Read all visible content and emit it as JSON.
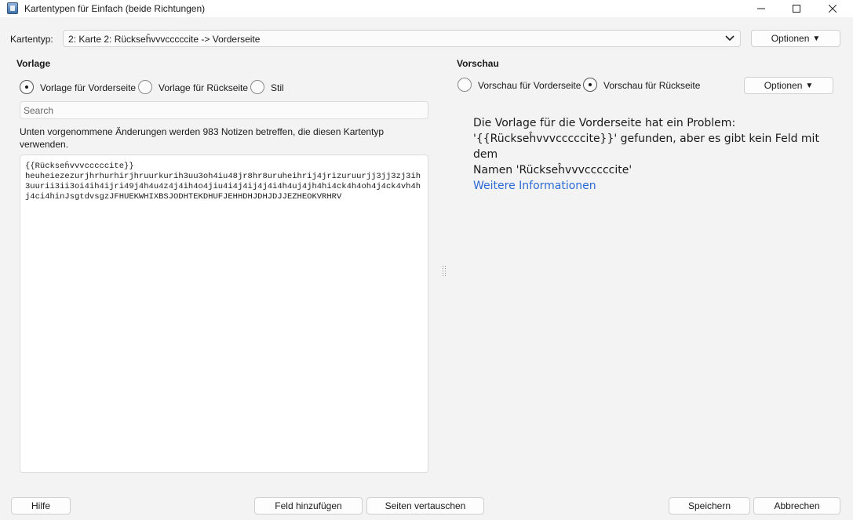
{
  "window": {
    "title": "Kartentypen für Einfach (beide Richtungen)"
  },
  "cardtype": {
    "label": "Kartentyp:",
    "selected": "2: Karte 2: Rückseĥvvvcccccite -> Vorderseite",
    "options_label": "Optionen"
  },
  "template": {
    "heading": "Vorlage",
    "radios": [
      {
        "label": "Vorlage für Vorderseite",
        "checked": true
      },
      {
        "label": "Vorlage für Rückseite",
        "checked": false
      },
      {
        "label": "Stil",
        "checked": false
      }
    ],
    "search_placeholder": "Search",
    "info": "Unten vorgenommene Änderungen werden 983 Notizen betreffen, die diesen Kartentyp verwenden.",
    "content": "{{Rückseĥvvvcccccite}}\nheuheiezezurjhrhurhirjhruurkurih3uu3oh4iu48jr8hr8uruheihrij4jrizuruurjj3jj3zj3ih3uurii3ii3oi4ih4ijri49j4h4u4z4j4ih4o4jiu4i4j4ij4j4i4h4uj4jh4hi4ck4h4oh4j4ck4vh4hj4ci4hinJsgtdvsgzJFHUEKWHIXBSJODHTEKDHUFJEHHDHJDHJDJJEZHEOKVRHRV"
  },
  "preview": {
    "heading": "Vorschau",
    "radios": [
      {
        "label": "Vorschau für Vorderseite",
        "checked": false
      },
      {
        "label": "Vorschau für Rückseite",
        "checked": true
      }
    ],
    "options_label": "Optionen",
    "message_line1": "Die Vorlage für die Vorderseite hat ein Problem:",
    "message_line2": "'{{Rückseĥvvvcccccite}}' gefunden, aber es gibt kein Feld mit dem",
    "message_line3": "Namen 'Rückseĥvvvcccccite'",
    "more_info": "Weitere Informationen"
  },
  "footer": {
    "help": "Hilfe",
    "add_field": "Feld hinzufügen",
    "swap_sides": "Seiten vertauschen",
    "save": "Speichern",
    "cancel": "Abbrechen"
  },
  "colors": {
    "link": "#2b6ad6",
    "background": "#f3f3f3"
  }
}
